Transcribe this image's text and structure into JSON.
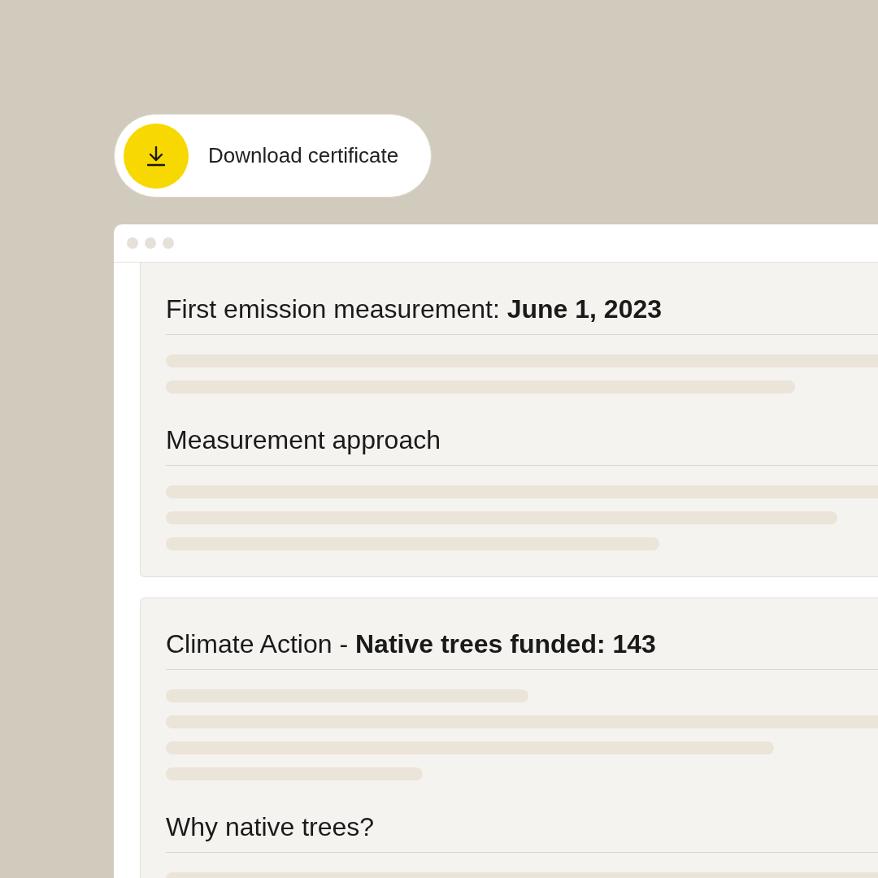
{
  "download_button": {
    "label": "Download certificate"
  },
  "cards": [
    {
      "sections": [
        {
          "heading": "First emission measurement: **June 1, 2023**"
        },
        {
          "heading": "Measurement approach"
        }
      ]
    },
    {
      "sections": [
        {
          "heading": "Climate Action - **Native trees funded: 143**"
        },
        {
          "heading": "Why native trees?"
        }
      ]
    }
  ]
}
